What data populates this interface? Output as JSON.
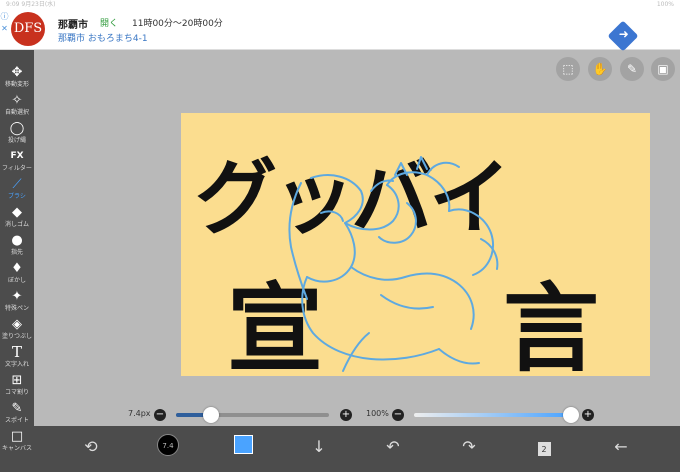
{
  "status": {
    "left": "9:09  9月23日(水)",
    "right": "100%"
  },
  "ad": {
    "info": "ⓘ ✕",
    "logo": "DFS",
    "name": "那覇市",
    "open": "開く",
    "hours": "11時00分〜20時00分",
    "address": "那覇市 おもろまち4-1"
  },
  "tools": [
    {
      "label": "移動変形",
      "icon": "move-icon"
    },
    {
      "label": "自動選択",
      "icon": "magic-wand-icon"
    },
    {
      "label": "投げ縄",
      "icon": "lasso-icon"
    },
    {
      "label": "フィルター",
      "icon": "fx-icon"
    },
    {
      "label": "ブラシ",
      "icon": "brush-icon"
    },
    {
      "label": "消しゴム",
      "icon": "eraser-icon"
    },
    {
      "label": "指先",
      "icon": "finger-icon"
    },
    {
      "label": "ぼかし",
      "icon": "blur-icon"
    },
    {
      "label": "特殊ペン",
      "icon": "special-pen-icon"
    },
    {
      "label": "塗りつぶし",
      "icon": "fill-icon"
    },
    {
      "label": "文字入れ",
      "icon": "text-icon"
    },
    {
      "label": "コマ割り",
      "icon": "panel-icon"
    },
    {
      "label": "スポイト",
      "icon": "eyedropper-icon"
    },
    {
      "label": "キャンバス",
      "icon": "canvas-icon"
    }
  ],
  "active_tool": "ブラシ",
  "canvas_text": {
    "line1": "グッバイ",
    "line2a": "宣",
    "line2b": "言"
  },
  "brush": {
    "size_label": "7.4px",
    "size_fraction": 0.23,
    "opacity_label": "100%",
    "opacity_fraction": 1.0,
    "preview_label": "7.4"
  },
  "colors": {
    "accent": "#4aa3ff",
    "canvas_bg": "#fbdd8f",
    "sketch_line": "#5ea9e0",
    "current_color": "#4aa3ff"
  },
  "bottom": {
    "layers_count": "2"
  }
}
